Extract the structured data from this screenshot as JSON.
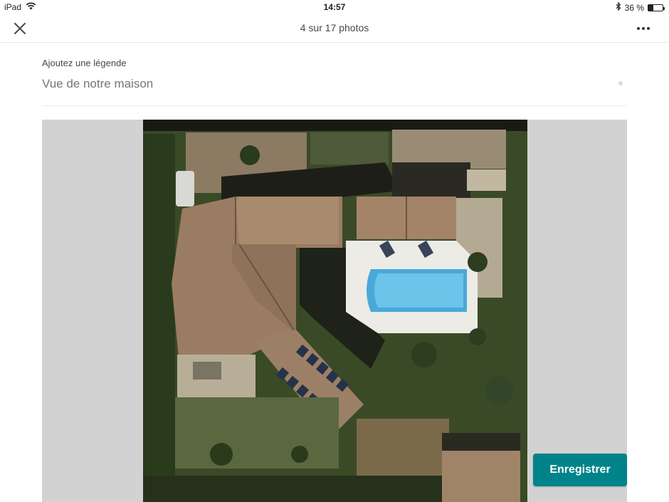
{
  "status_bar": {
    "device": "iPad",
    "time": "14:57",
    "battery": "36 %",
    "battery_level": 0.36
  },
  "header": {
    "title": "4 sur 17 photos",
    "close_icon": "close-icon",
    "more_icon": "more-options-icon"
  },
  "caption": {
    "label": "Ajoutez une légende",
    "value": "Vue de notre maison"
  },
  "photo": {
    "subject": "aerial-house-pool-image"
  },
  "actions": {
    "save_label": "Enregistrer"
  },
  "colors": {
    "accent": "#008489",
    "stage_background": "#d2d2d2"
  }
}
